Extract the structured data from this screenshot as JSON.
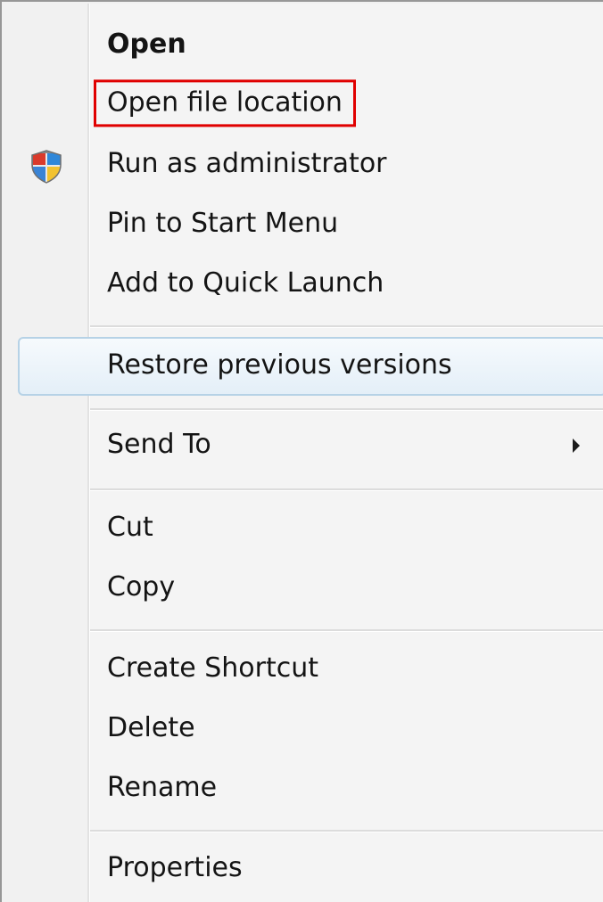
{
  "menu": {
    "items": [
      {
        "id": "open",
        "label": "Open"
      },
      {
        "id": "open-file-location",
        "label": "Open file location"
      },
      {
        "id": "run-as-administrator",
        "label": "Run as administrator",
        "icon": "uac-shield-icon"
      },
      {
        "id": "pin-to-start-menu",
        "label": "Pin to Start Menu"
      },
      {
        "id": "add-to-quick-launch",
        "label": "Add to Quick Launch"
      },
      {
        "id": "restore-previous-versions",
        "label": "Restore previous versions"
      },
      {
        "id": "send-to",
        "label": "Send To",
        "icon": "submenu-arrow-icon"
      },
      {
        "id": "cut",
        "label": "Cut"
      },
      {
        "id": "copy",
        "label": "Copy"
      },
      {
        "id": "create-shortcut",
        "label": "Create Shortcut"
      },
      {
        "id": "delete",
        "label": "Delete"
      },
      {
        "id": "rename",
        "label": "Rename"
      },
      {
        "id": "properties",
        "label": "Properties"
      }
    ]
  },
  "colors": {
    "highlight_box": "#e00000",
    "hover_border": "#b6d2e6",
    "menu_background": "#f1f1f1"
  }
}
